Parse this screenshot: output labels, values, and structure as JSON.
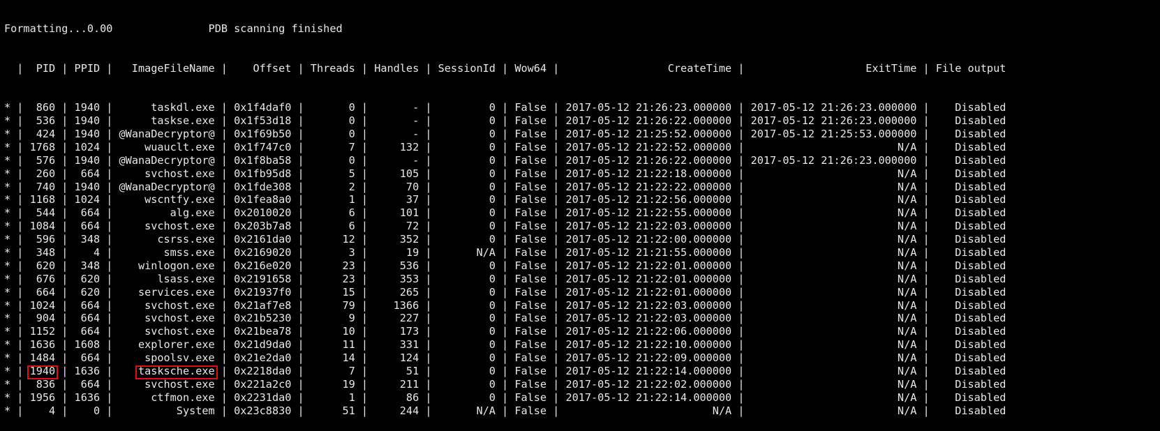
{
  "status": {
    "progress_text": "Formatting...0.00",
    "message": "PDB scanning finished"
  },
  "table": {
    "headers": [
      "",
      "PID",
      "PPID",
      "ImageFileName",
      "Offset",
      "Threads",
      "Handles",
      "SessionId",
      "Wow64",
      "CreateTime",
      "ExitTime",
      "File output"
    ],
    "rows": [
      [
        "*",
        "860",
        "1940",
        "taskdl.exe",
        "0x1f4daf0",
        "0",
        "-",
        "0",
        "False",
        "2017-05-12 21:26:23.000000",
        "2017-05-12 21:26:23.000000",
        "Disabled"
      ],
      [
        "*",
        "536",
        "1940",
        "taskse.exe",
        "0x1f53d18",
        "0",
        "-",
        "0",
        "False",
        "2017-05-12 21:26:22.000000",
        "2017-05-12 21:26:23.000000",
        "Disabled"
      ],
      [
        "*",
        "424",
        "1940",
        "@WanaDecryptor@",
        "0x1f69b50",
        "0",
        "-",
        "0",
        "False",
        "2017-05-12 21:25:52.000000",
        "2017-05-12 21:25:53.000000",
        "Disabled"
      ],
      [
        "*",
        "1768",
        "1024",
        "wuauclt.exe",
        "0x1f747c0",
        "7",
        "132",
        "0",
        "False",
        "2017-05-12 21:22:52.000000",
        "N/A",
        "Disabled"
      ],
      [
        "*",
        "576",
        "1940",
        "@WanaDecryptor@",
        "0x1f8ba58",
        "0",
        "-",
        "0",
        "False",
        "2017-05-12 21:26:22.000000",
        "2017-05-12 21:26:23.000000",
        "Disabled"
      ],
      [
        "*",
        "260",
        "664",
        "svchost.exe",
        "0x1fb95d8",
        "5",
        "105",
        "0",
        "False",
        "2017-05-12 21:22:18.000000",
        "N/A",
        "Disabled"
      ],
      [
        "*",
        "740",
        "1940",
        "@WanaDecryptor@",
        "0x1fde308",
        "2",
        "70",
        "0",
        "False",
        "2017-05-12 21:22:22.000000",
        "N/A",
        "Disabled"
      ],
      [
        "*",
        "1168",
        "1024",
        "wscntfy.exe",
        "0x1fea8a0",
        "1",
        "37",
        "0",
        "False",
        "2017-05-12 21:22:56.000000",
        "N/A",
        "Disabled"
      ],
      [
        "*",
        "544",
        "664",
        "alg.exe",
        "0x2010020",
        "6",
        "101",
        "0",
        "False",
        "2017-05-12 21:22:55.000000",
        "N/A",
        "Disabled"
      ],
      [
        "*",
        "1084",
        "664",
        "svchost.exe",
        "0x203b7a8",
        "6",
        "72",
        "0",
        "False",
        "2017-05-12 21:22:03.000000",
        "N/A",
        "Disabled"
      ],
      [
        "*",
        "596",
        "348",
        "csrss.exe",
        "0x2161da0",
        "12",
        "352",
        "0",
        "False",
        "2017-05-12 21:22:00.000000",
        "N/A",
        "Disabled"
      ],
      [
        "*",
        "348",
        "4",
        "smss.exe",
        "0x2169020",
        "3",
        "19",
        "N/A",
        "False",
        "2017-05-12 21:21:55.000000",
        "N/A",
        "Disabled"
      ],
      [
        "*",
        "620",
        "348",
        "winlogon.exe",
        "0x216e020",
        "23",
        "536",
        "0",
        "False",
        "2017-05-12 21:22:01.000000",
        "N/A",
        "Disabled"
      ],
      [
        "*",
        "676",
        "620",
        "lsass.exe",
        "0x2191658",
        "23",
        "353",
        "0",
        "False",
        "2017-05-12 21:22:01.000000",
        "N/A",
        "Disabled"
      ],
      [
        "*",
        "664",
        "620",
        "services.exe",
        "0x21937f0",
        "15",
        "265",
        "0",
        "False",
        "2017-05-12 21:22:01.000000",
        "N/A",
        "Disabled"
      ],
      [
        "*",
        "1024",
        "664",
        "svchost.exe",
        "0x21af7e8",
        "79",
        "1366",
        "0",
        "False",
        "2017-05-12 21:22:03.000000",
        "N/A",
        "Disabled"
      ],
      [
        "*",
        "904",
        "664",
        "svchost.exe",
        "0x21b5230",
        "9",
        "227",
        "0",
        "False",
        "2017-05-12 21:22:03.000000",
        "N/A",
        "Disabled"
      ],
      [
        "*",
        "1152",
        "664",
        "svchost.exe",
        "0x21bea78",
        "10",
        "173",
        "0",
        "False",
        "2017-05-12 21:22:06.000000",
        "N/A",
        "Disabled"
      ],
      [
        "*",
        "1636",
        "1608",
        "explorer.exe",
        "0x21d9da0",
        "11",
        "331",
        "0",
        "False",
        "2017-05-12 21:22:10.000000",
        "N/A",
        "Disabled"
      ],
      [
        "*",
        "1484",
        "664",
        "spoolsv.exe",
        "0x21e2da0",
        "14",
        "124",
        "0",
        "False",
        "2017-05-12 21:22:09.000000",
        "N/A",
        "Disabled"
      ],
      [
        "*",
        "1940",
        "1636",
        "tasksche.exe",
        "0x2218da0",
        "7",
        "51",
        "0",
        "False",
        "2017-05-12 21:22:14.000000",
        "N/A",
        "Disabled"
      ],
      [
        "*",
        "836",
        "664",
        "svchost.exe",
        "0x221a2c0",
        "19",
        "211",
        "0",
        "False",
        "2017-05-12 21:22:02.000000",
        "N/A",
        "Disabled"
      ],
      [
        "*",
        "1956",
        "1636",
        "ctfmon.exe",
        "0x2231da0",
        "1",
        "86",
        "0",
        "False",
        "2017-05-12 21:22:14.000000",
        "N/A",
        "Disabled"
      ],
      [
        "*",
        "4",
        "0",
        "System",
        "0x23c8830",
        "51",
        "244",
        "N/A",
        "False",
        "N/A",
        "N/A",
        "Disabled"
      ]
    ],
    "highlighted_row_index": 20,
    "highlight_color": "#e01010"
  },
  "colors": {
    "background": "#000000",
    "text": "#e8e8e8",
    "highlight": "#e01010"
  }
}
